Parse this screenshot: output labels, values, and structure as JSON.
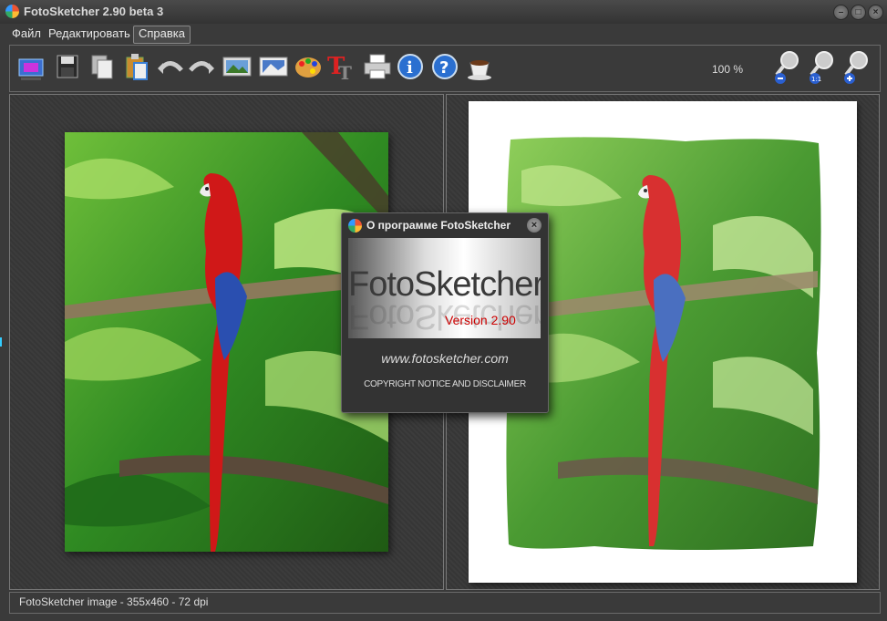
{
  "window": {
    "title": "FotoSketcher 2.90 beta 3"
  },
  "menu": {
    "items": [
      "Файл",
      "Редактировать",
      "Справка"
    ]
  },
  "toolbar": {
    "zoom_label": "100 %",
    "buttons": [
      "open-image",
      "save",
      "copy",
      "paste",
      "undo",
      "redo",
      "original-image",
      "result-image",
      "paint-palette",
      "text",
      "print",
      "info",
      "help",
      "coffee-donate"
    ],
    "zoom_buttons": [
      "zoom-out",
      "zoom-1-1",
      "zoom-in"
    ]
  },
  "status": {
    "text": "FotoSketcher image - 355x460 - 72 dpi"
  },
  "about_dialog": {
    "title": "О программе FotoSketcher",
    "logo_text": "FotoSketcher",
    "version": "Version 2.90",
    "url": "www.fotosketcher.com",
    "copyright": "COPYRIGHT NOTICE AND DISCLAIMER"
  },
  "colors": {
    "background": "#3a3a3a",
    "version_text": "#cc0000",
    "parrot_red": "#d01818",
    "foliage_green": "#3c9a2a"
  }
}
